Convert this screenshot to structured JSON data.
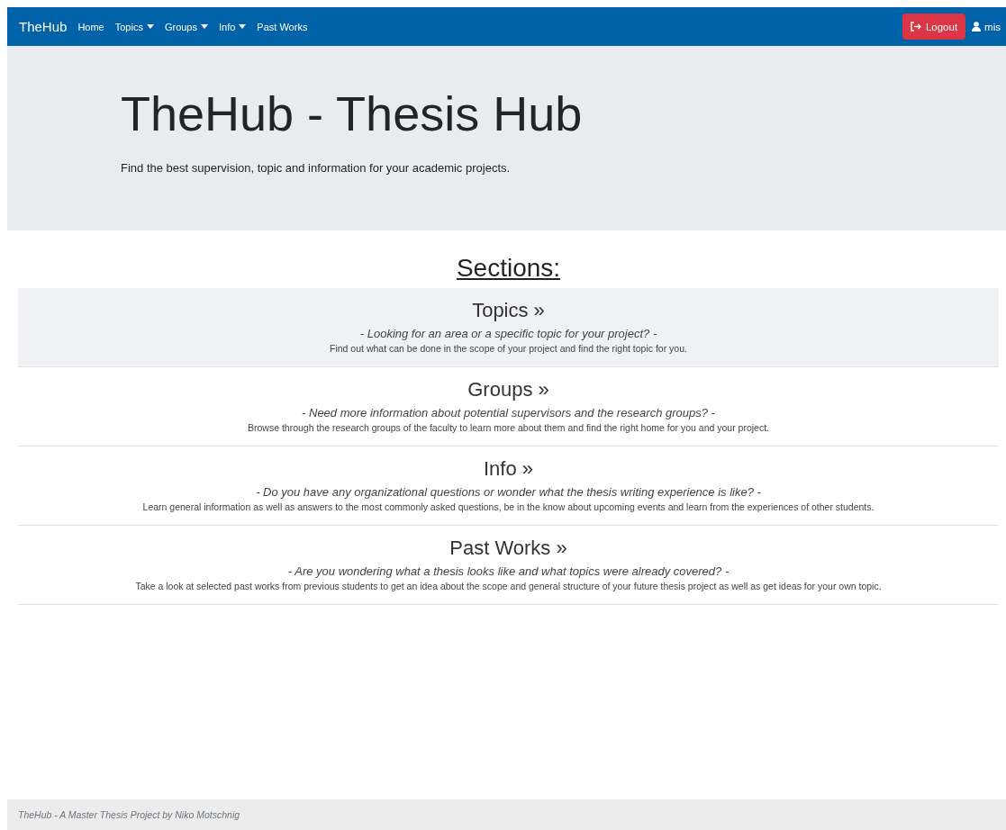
{
  "navbar": {
    "brand": "TheHub",
    "items": [
      {
        "label": "Home",
        "kind": "link"
      },
      {
        "label": "Topics",
        "kind": "dropdown"
      },
      {
        "label": "Groups",
        "kind": "dropdown"
      },
      {
        "label": "Info",
        "kind": "dropdown"
      },
      {
        "label": "Past Works",
        "kind": "link"
      }
    ],
    "logout": "Logout",
    "user": "mis"
  },
  "hero": {
    "title": "TheHub - Thesis Hub",
    "subtitle": "Find the best supervision, topic and information for your academic projects."
  },
  "sections_heading": "Sections:",
  "sections": [
    {
      "title": "Topics »",
      "question": "- Looking for an area or a specific topic for your project? -",
      "description": "Find out what can be done in the scope of your project and find the right topic for you.",
      "selected": true
    },
    {
      "title": "Groups »",
      "question": "- Need more information about potential supervisors and the research groups? -",
      "description": "Browse through the research groups of the faculty to learn more about them and find the right home for you and your project.",
      "selected": false
    },
    {
      "title": "Info »",
      "question": "- Do you have any organizational questions or wonder what the thesis writing experience is like? -",
      "description": "Learn general information as well as answers to the most commonly asked questions, be in the know about upcoming events and learn from the experiences of other students.",
      "selected": false
    },
    {
      "title": "Past Works »",
      "question": "- Are you wondering what a thesis looks like and what topics were already covered? -",
      "description": "Take a look at selected past works from previous students to get an idea about the scope and general structure of your future thesis project as well as get ideas for your own topic.",
      "selected": false
    }
  ],
  "footer": "TheHub - A Master Thesis Project by Niko Motschnig"
}
